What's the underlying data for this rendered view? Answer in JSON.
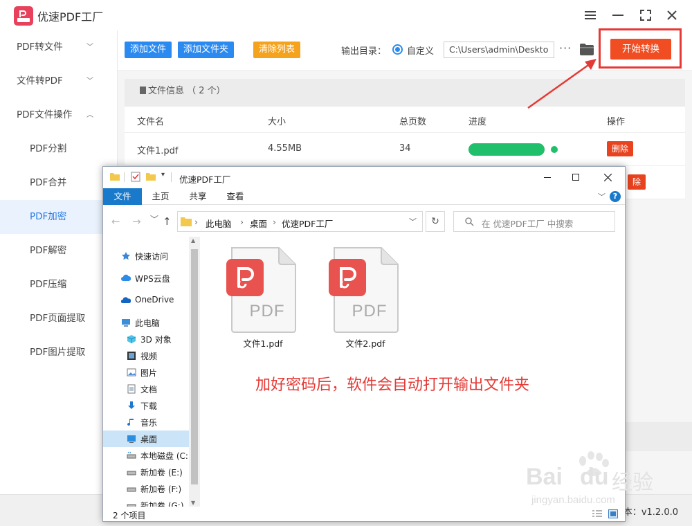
{
  "app": {
    "title": "优速PDF工厂",
    "version": "本：v1.2.0.0"
  },
  "sidebar": {
    "items": [
      {
        "label": "PDF转文件",
        "chevron": "﹀"
      },
      {
        "label": "文件转PDF",
        "chevron": "﹀"
      },
      {
        "label": "PDF文件操作",
        "chevron": "︿"
      },
      {
        "label": "PDF分割"
      },
      {
        "label": "PDF合并"
      },
      {
        "label": "PDF加密"
      },
      {
        "label": "PDF解密"
      },
      {
        "label": "PDF压缩"
      },
      {
        "label": "PDF页面提取"
      },
      {
        "label": "PDF图片提取"
      }
    ]
  },
  "toolbar": {
    "add_file": "添加文件",
    "add_folder": "添加文件夹",
    "clear_list": "清除列表",
    "output_label": "输出目录：",
    "custom_label": "自定义",
    "output_path": "C:\\Users\\admin\\Deskto",
    "more": "···",
    "start": "开始转换"
  },
  "file_list": {
    "header": "文件信息 （ 2 个）",
    "columns": [
      "文件名",
      "大小",
      "总页数",
      "进度",
      "操作"
    ],
    "rows": [
      {
        "name": "文件1.pdf",
        "size": "4.55MB",
        "pages": "34",
        "progress": 1.0,
        "action": "删除"
      },
      {
        "name": "",
        "size": "",
        "pages": "",
        "action": "除"
      }
    ]
  },
  "explorer": {
    "title": "优速PDF工厂",
    "ribbon_tabs": [
      "文件",
      "主页",
      "共享",
      "查看"
    ],
    "help": "?",
    "breadcrumb": [
      "此电脑",
      "桌面",
      "优速PDF工厂"
    ],
    "search_placeholder": "在 优速PDF工厂 中搜索",
    "nav": [
      {
        "label": "快速访问",
        "icon": "star-icon"
      },
      {
        "label": "WPS云盘",
        "icon": "cloud-icon"
      },
      {
        "label": "OneDrive",
        "icon": "onedrive-icon"
      },
      {
        "label": "此电脑",
        "icon": "computer-icon"
      },
      {
        "label": "3D 对象",
        "icon": "cube-icon"
      },
      {
        "label": "视频",
        "icon": "video-icon"
      },
      {
        "label": "图片",
        "icon": "picture-icon"
      },
      {
        "label": "文档",
        "icon": "document-icon"
      },
      {
        "label": "下载",
        "icon": "download-icon"
      },
      {
        "label": "音乐",
        "icon": "music-icon"
      },
      {
        "label": "桌面",
        "icon": "desktop-icon"
      },
      {
        "label": "本地磁盘 (C:)",
        "icon": "drive-icon"
      },
      {
        "label": "新加卷 (E:)",
        "icon": "drive-icon"
      },
      {
        "label": "新加卷 (F:)",
        "icon": "drive-icon"
      },
      {
        "label": "新加卷 (G:)",
        "icon": "drive-icon"
      }
    ],
    "files": [
      {
        "name": "文件1.pdf",
        "badge": "PDF"
      },
      {
        "name": "文件2.pdf",
        "badge": "PDF"
      }
    ],
    "annotation": "加好密码后，软件会自动打开输出文件夹",
    "item_count": "2 个项目"
  },
  "colors": {
    "accent_blue": "#2b8af0",
    "clear_orange": "#f5a21c",
    "start_red": "#f04d22",
    "annotation_red": "#e53935",
    "progress_green": "#1fbf6b",
    "pdf_icon_red": "#e8534f"
  },
  "watermark": {
    "brand": "Bai",
    "brand2": "du",
    "suffix": "经验",
    "url": "jingyan.baidu.com"
  }
}
